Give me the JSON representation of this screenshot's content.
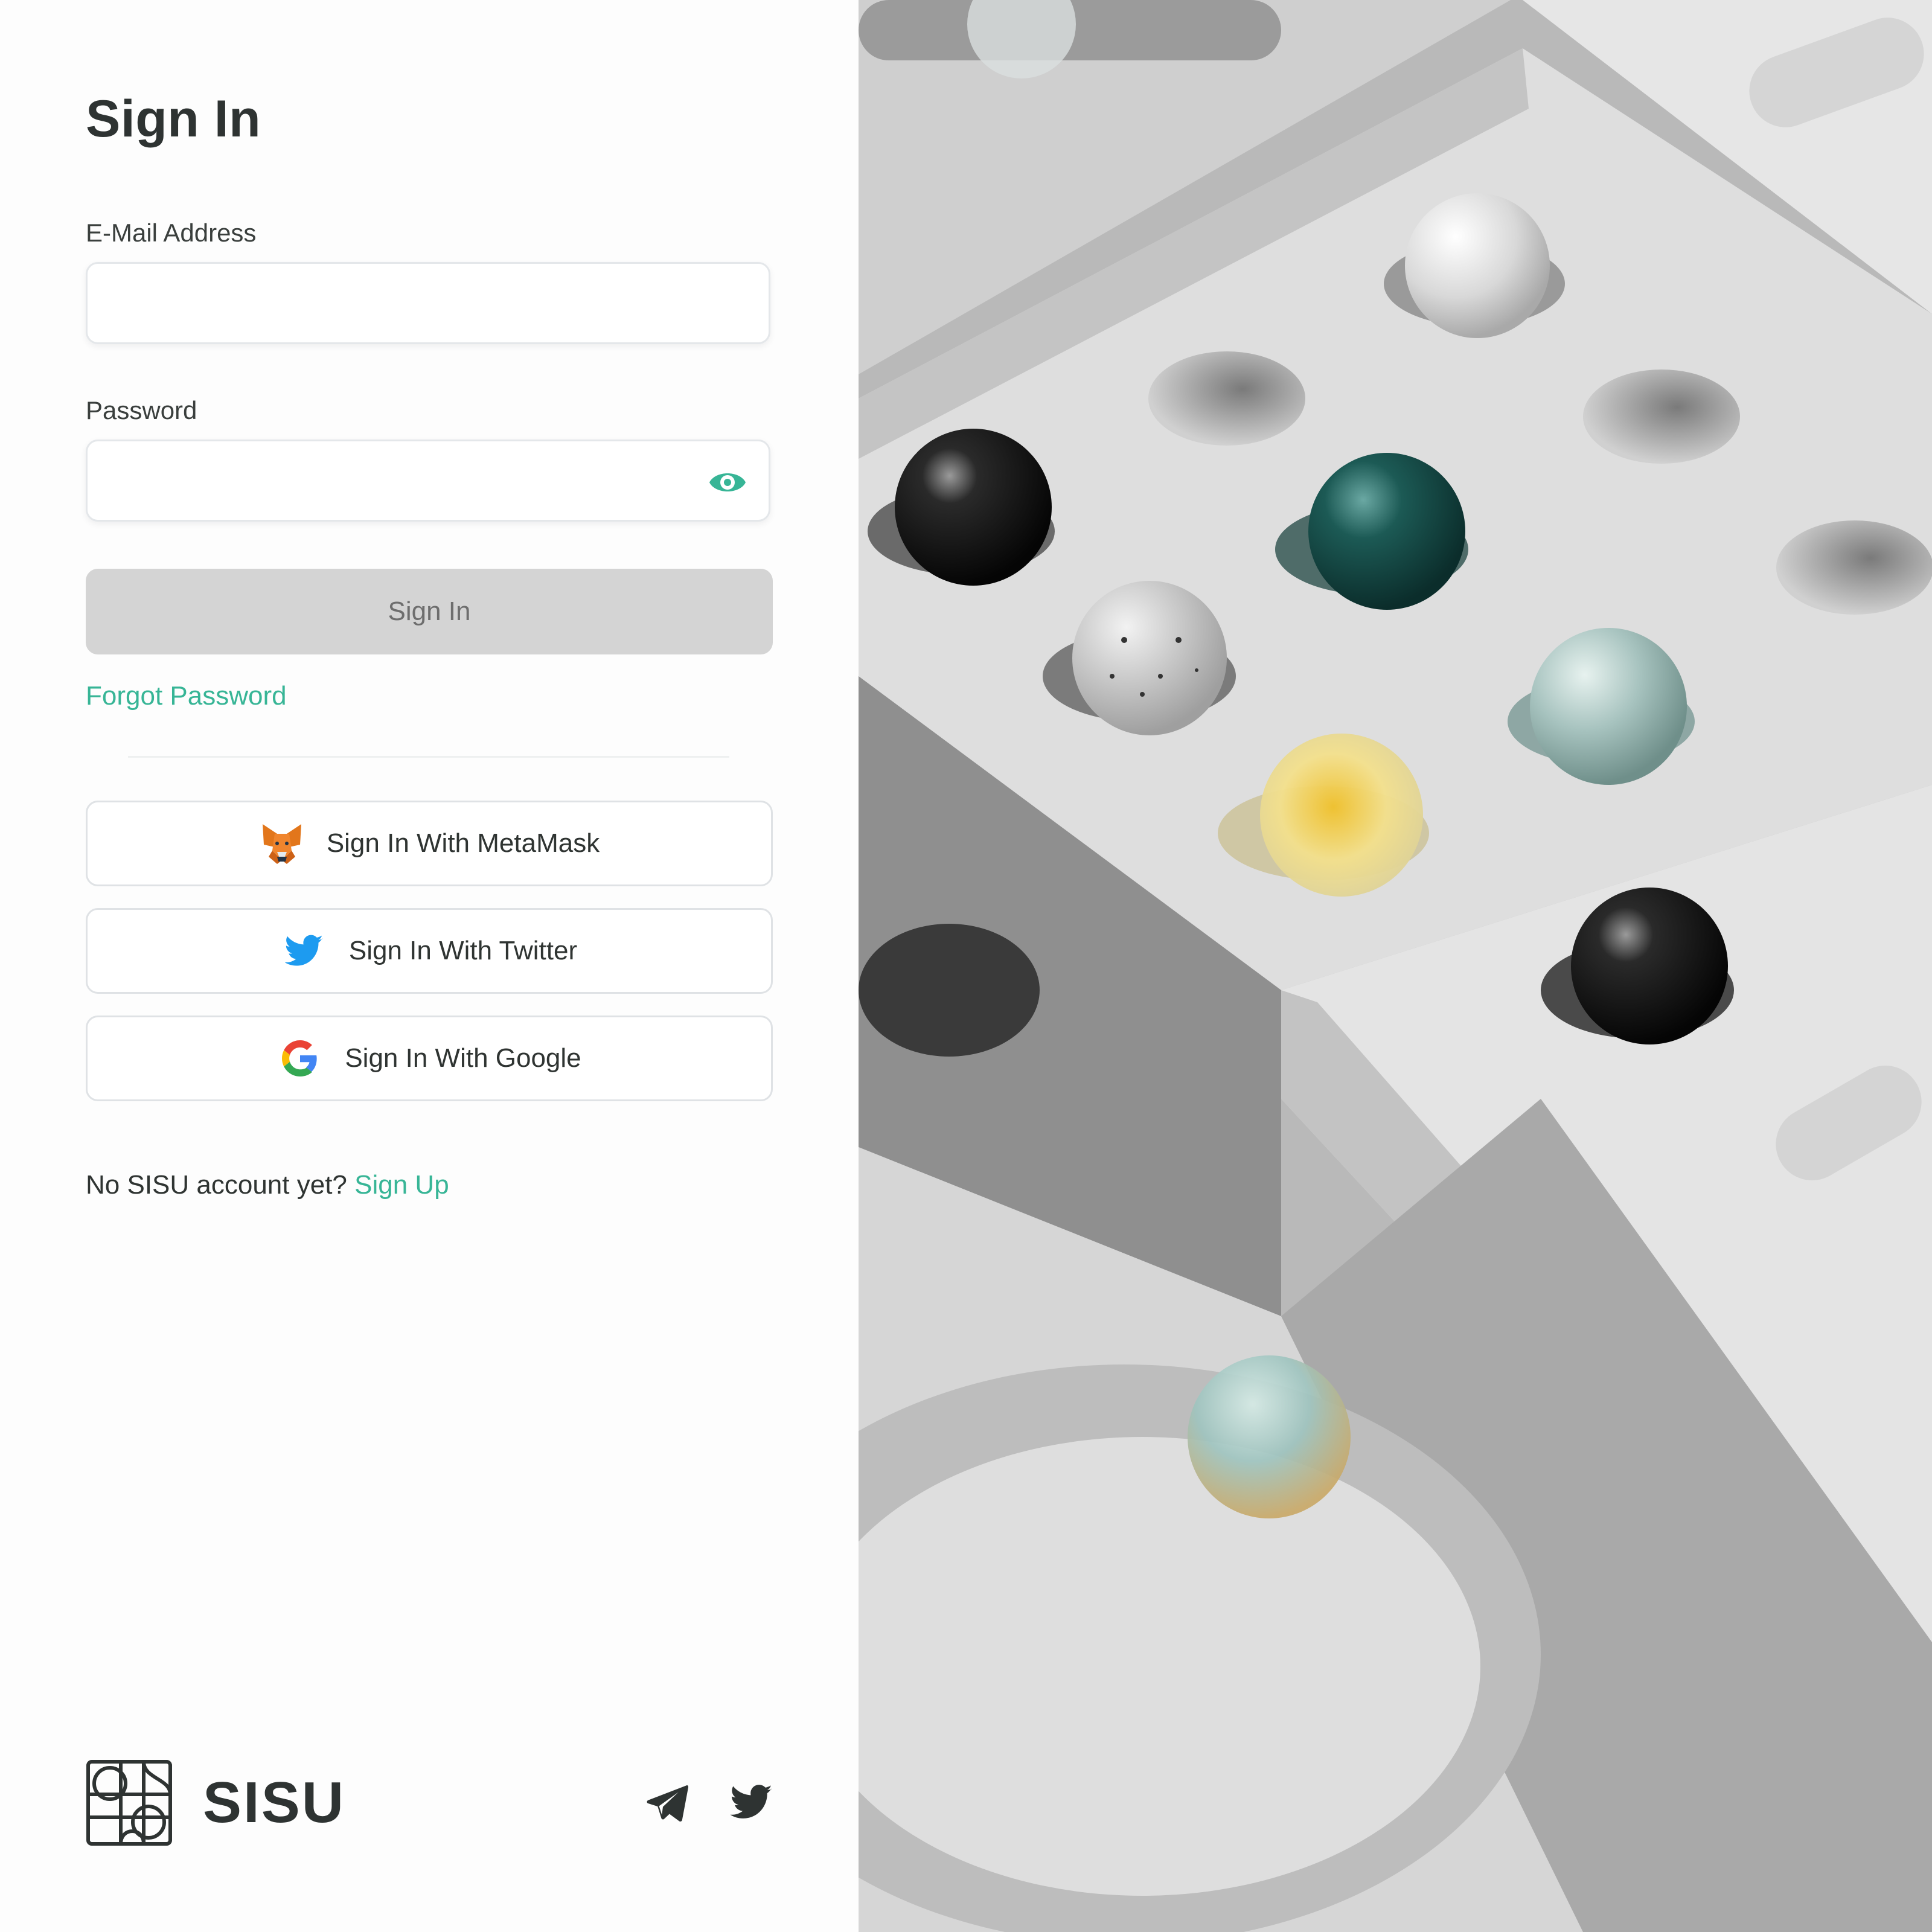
{
  "title": "Sign In",
  "email": {
    "label": "E-Mail Address",
    "value": "",
    "placeholder": ""
  },
  "password": {
    "label": "Password",
    "value": "",
    "placeholder": "",
    "toggle_icon": "eye-icon"
  },
  "submit_label": "Sign In",
  "forgot_label": "Forgot Password",
  "social": {
    "metamask_label": "Sign In With MetaMask",
    "twitter_label": "Sign In With Twitter",
    "google_label": "Sign In With Google"
  },
  "signup": {
    "prompt": "No SISU account yet?",
    "link": "Sign Up"
  },
  "footer": {
    "brand_name": "SISU",
    "icons": [
      "telegram-icon",
      "twitter-icon"
    ]
  },
  "colors": {
    "accent": "#37b596",
    "title_text": "#2e3332",
    "button_disabled_bg": "#d4d4d4",
    "button_disabled_text": "#6e6e6e",
    "twitter_blue": "#1d9bf0",
    "metamask_orange": "#e2761b"
  }
}
